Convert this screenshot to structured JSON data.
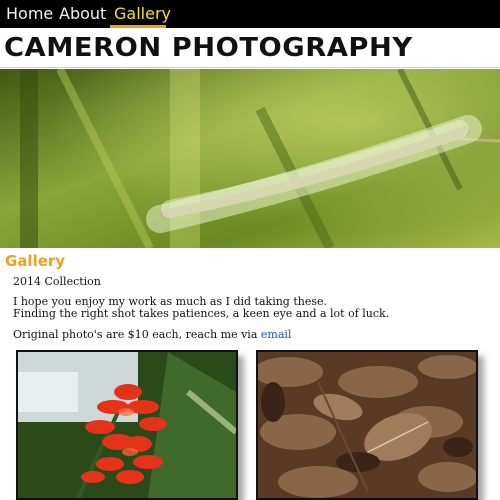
{
  "nav": {
    "items": [
      {
        "label": "Home"
      },
      {
        "label": "About"
      },
      {
        "label": "Gallery"
      }
    ],
    "active_index": 2
  },
  "header": {
    "title": "CAMERON PHOTOGRAPHY"
  },
  "hero": {
    "image": "grass-seed-head-photo"
  },
  "gallery": {
    "title": "Gallery",
    "collection": "2014 Collection",
    "intro_line1": "I hope you enjoy my work as much as I did taking these.",
    "intro_line2": "Finding the right shot takes patiences, a keen eye and a lot of luck.",
    "price_text": "Original photo's are $10 each, reach me via",
    "contact_link": "email",
    "photos": [
      {
        "subject": "red-flower-photo"
      },
      {
        "subject": "autumn-leaves-photo"
      }
    ]
  },
  "colors": {
    "nav_bg": "#000000",
    "nav_active": "#f5e21a",
    "accent": "#f0a020",
    "link": "#1a55c4"
  }
}
